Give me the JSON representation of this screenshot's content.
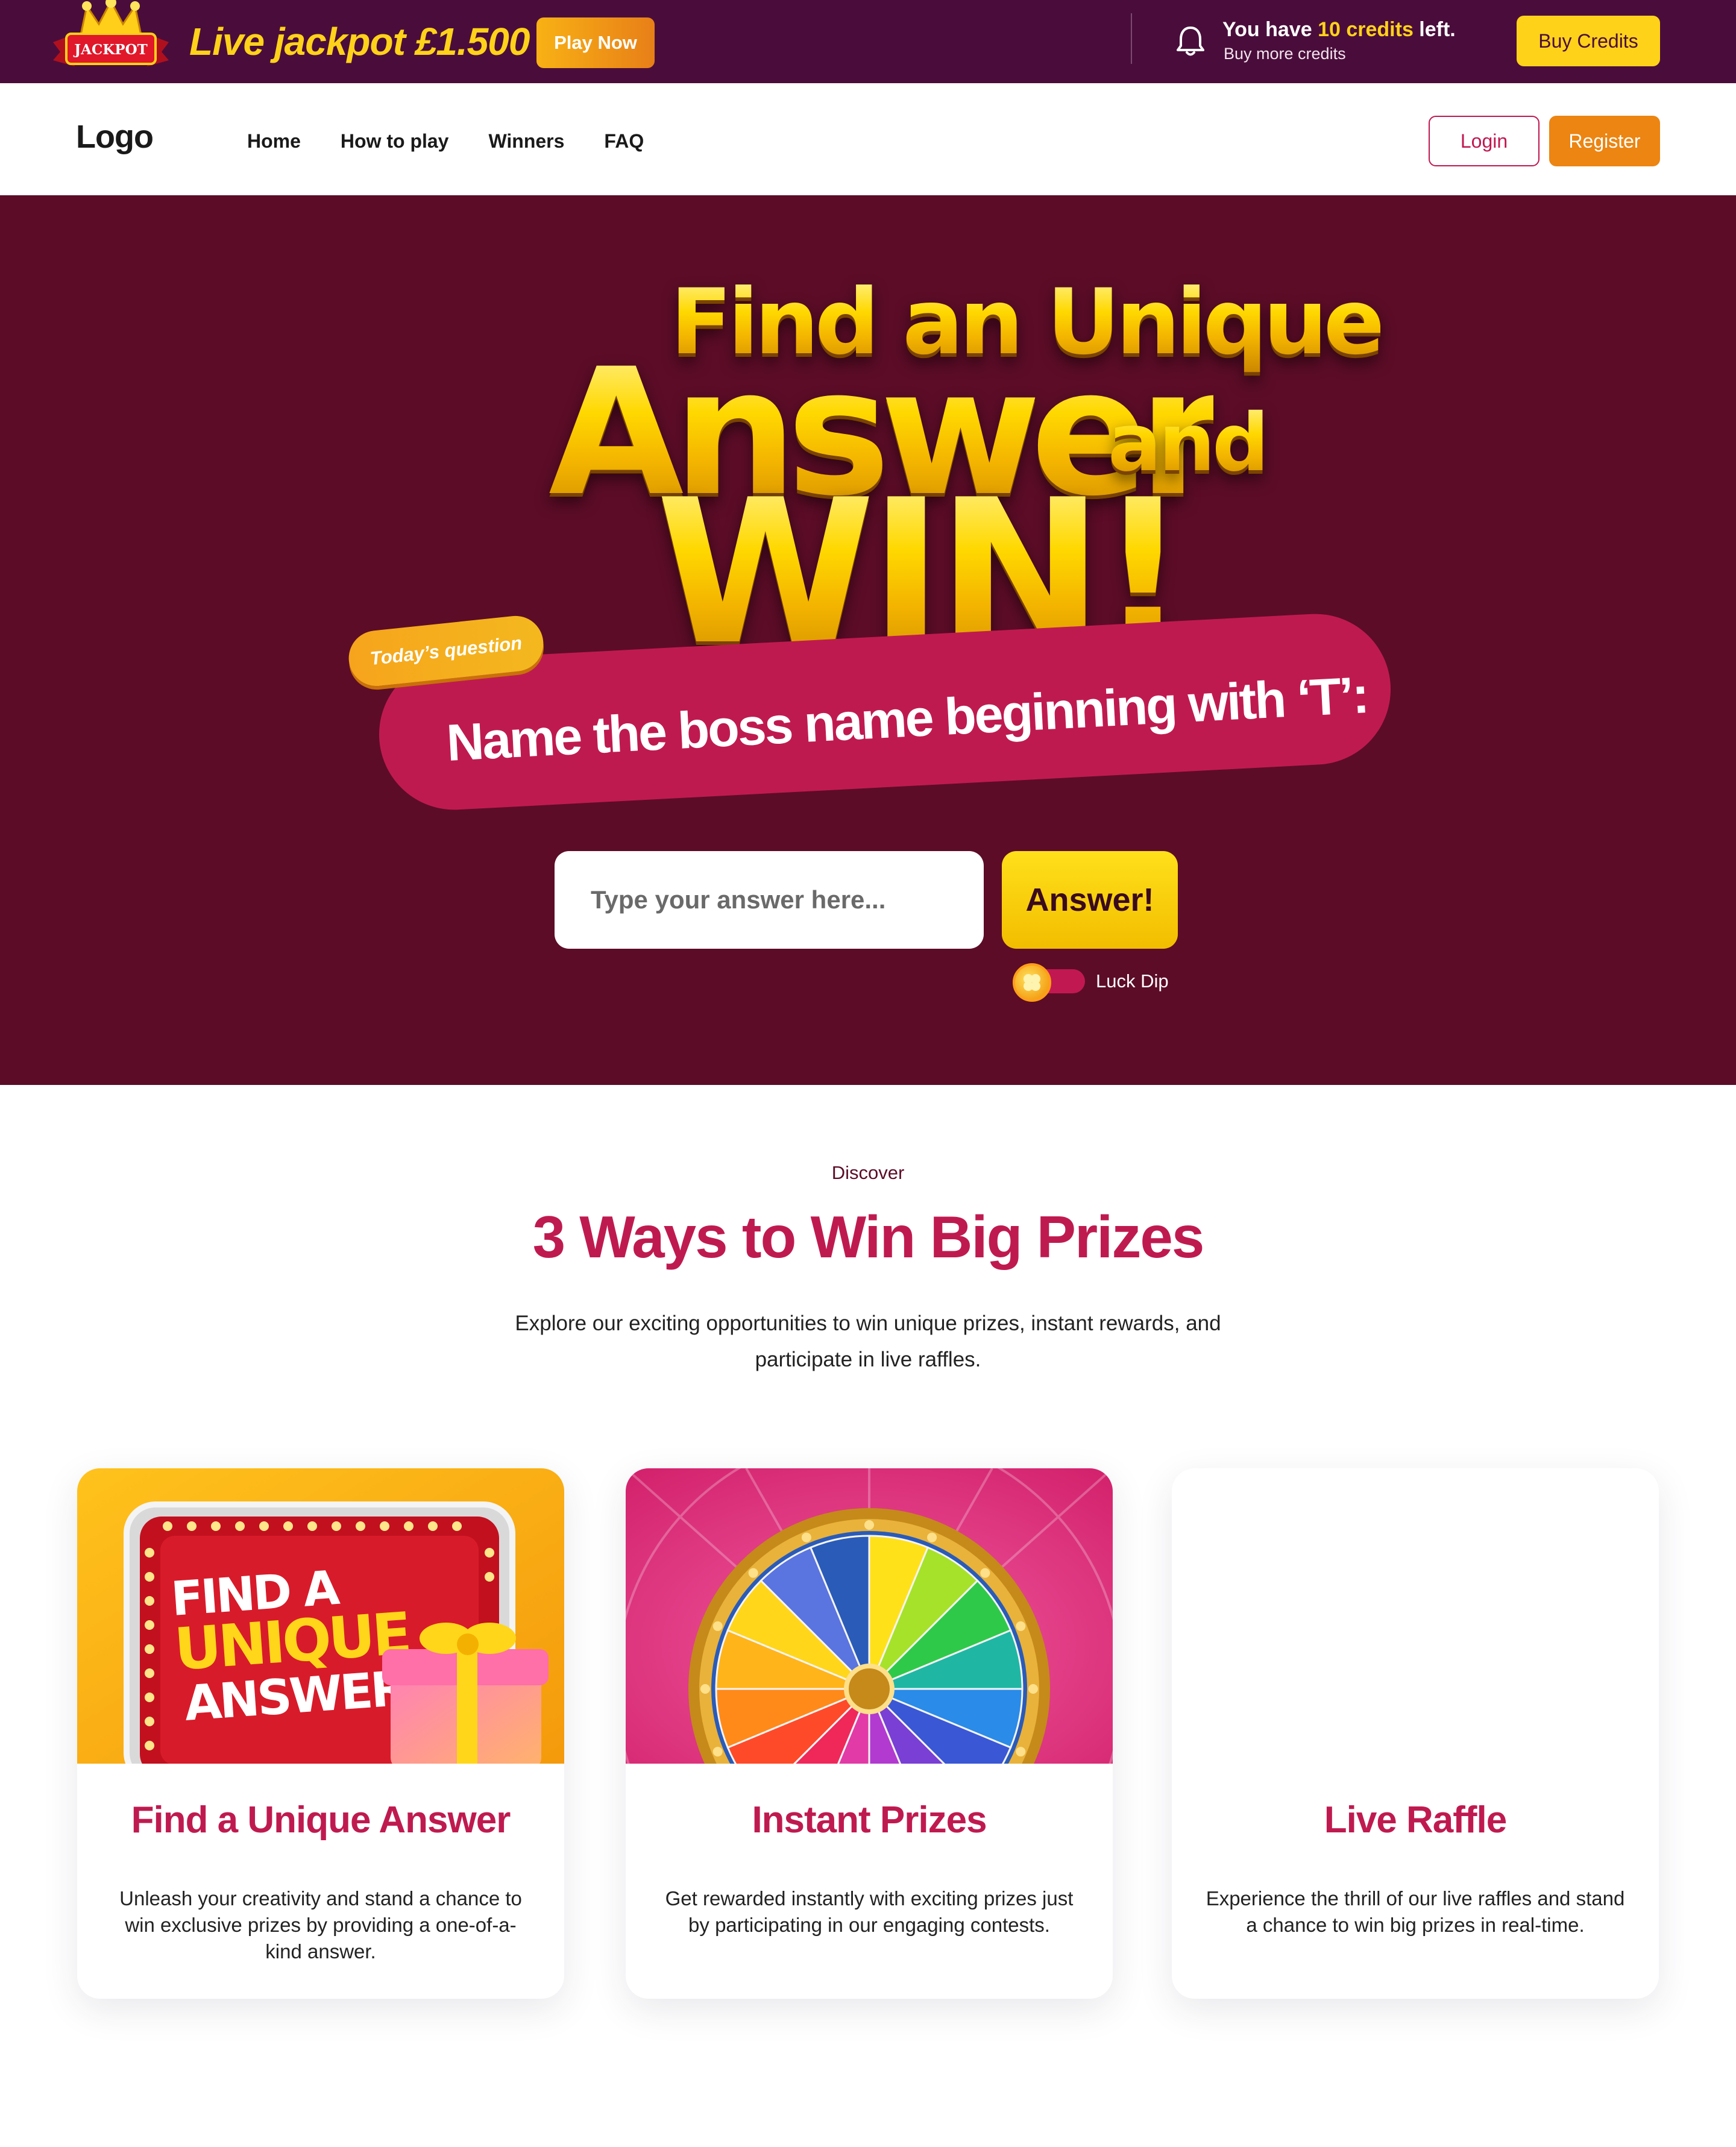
{
  "topbar": {
    "jackpot_badge": "JACKPOT",
    "live_jackpot": "Live jackpot £1.500",
    "play_now": "Play Now",
    "credits_prefix": "You have ",
    "credits_amount": "10 credits",
    "credits_suffix": " left.",
    "buy_more": "Buy more credits",
    "buy_credits": "Buy Credits"
  },
  "nav": {
    "logo": "Logo",
    "links": [
      "Home",
      "How to play",
      "Winners",
      "FAQ"
    ],
    "login": "Login",
    "register": "Register"
  },
  "hero": {
    "headline_1": "Find an Unique",
    "headline_2": "Answer",
    "headline_3": "and",
    "headline_4": "WIN!",
    "todays_question_tag": "Today’s question",
    "question": "Name the boss name beginning with ‘T’:",
    "answer_placeholder": "Type your answer here...",
    "answer_button": "Answer!",
    "lucky_dip_label": "Luck Dip"
  },
  "ways": {
    "eyebrow": "Discover",
    "title": "3 Ways to Win Big Prizes",
    "description": "Explore our exciting opportunities to win unique prizes, instant rewards, and participate in live raffles.",
    "cards": [
      {
        "image_text_1": "FIND A",
        "image_text_2": "UNIQUE",
        "image_text_3": "ANSWER",
        "title": "Find a Unique Answer",
        "description": "Unleash your creativity and stand a chance to win exclusive prizes by providing a one-of-a-kind answer."
      },
      {
        "title": "Instant Prizes",
        "description": "Get rewarded instantly with exciting prizes just by participating in our engaging contests."
      },
      {
        "title": "Live Raffle",
        "description": "Experience the thrill of our live raffles and stand a chance to win big prizes in real-time."
      }
    ]
  },
  "colors": {
    "topbar_bg": "#4a0d3b",
    "hero_bg": "#5c0c27",
    "brand_pink": "#bf1a50",
    "accent_yellow": "#ffd21a",
    "accent_orange": "#ec8512"
  },
  "icons": [
    "jackpot-badge-icon",
    "bell-icon",
    "clover-icon",
    "gift-icon",
    "prize-wheel-icon"
  ]
}
